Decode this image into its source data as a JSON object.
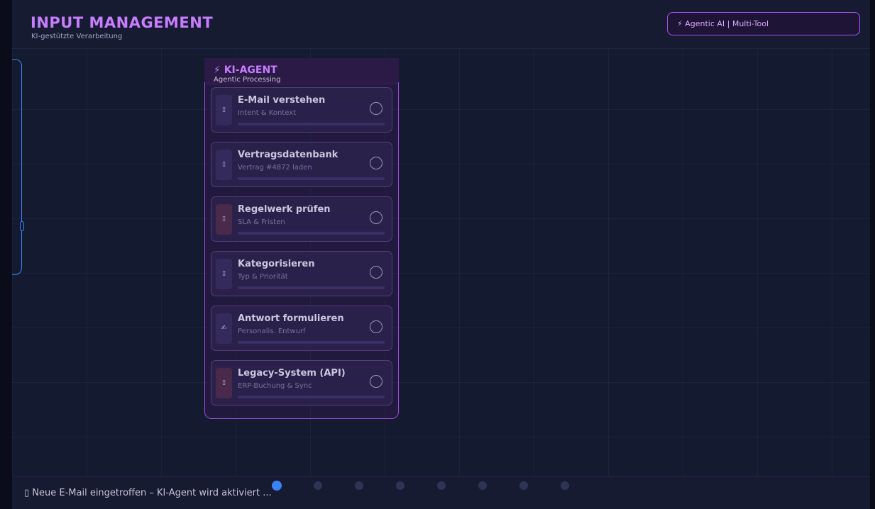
{
  "header": {
    "title": "INPUT MANAGEMENT",
    "subtitle": "KI-gestützte Verarbeitung",
    "badge": "⚡ Agentic AI  |  Multi-Tool"
  },
  "agent": {
    "title": "⚡ KI-AGENT",
    "subtitle": "Agentic Processing",
    "steps": [
      {
        "name": "E-Mail verstehen",
        "detail": "Intent & Kontext",
        "icon": "mail-icon",
        "glyph": "▯"
      },
      {
        "name": "Vertragsdatenbank",
        "detail": "Vertrag #4872 laden",
        "icon": "database-icon",
        "glyph": "▯"
      },
      {
        "name": "Regelwerk prüfen",
        "detail": "SLA & Fristen",
        "icon": "rules-icon",
        "glyph": "▯"
      },
      {
        "name": "Kategorisieren",
        "detail": "Typ & Priorität",
        "icon": "tag-icon",
        "glyph": "▯"
      },
      {
        "name": "Antwort formulieren",
        "detail": "Personalis. Entwurf",
        "icon": "pen-icon",
        "glyph": "✍"
      },
      {
        "name": "Legacy-System (API)",
        "detail": "ERP-Buchung & Sync",
        "icon": "server-icon",
        "glyph": "▯"
      }
    ]
  },
  "footer": {
    "status": "▯  Neue E-Mail eingetroffen – KI-Agent wird aktiviert ..."
  },
  "progress": {
    "total_steps": 8,
    "current_step": 1
  },
  "colors": {
    "accent": "#c77dff",
    "active_dot": "#3b82f6",
    "panel_border": "#9d4edd"
  }
}
